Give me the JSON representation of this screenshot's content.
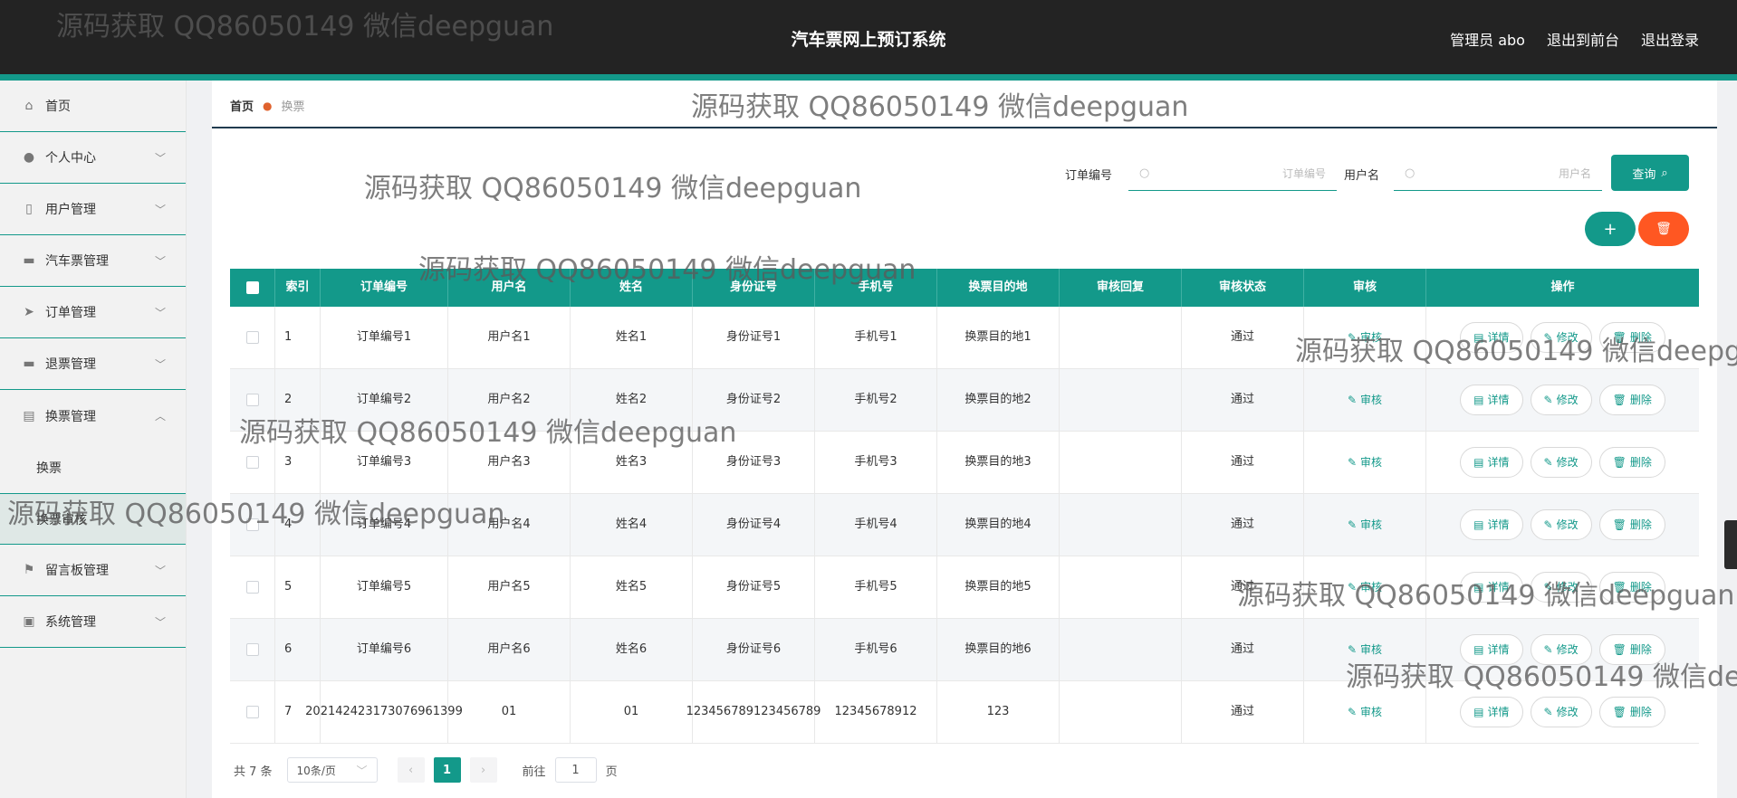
{
  "header": {
    "title": "汽车票网上预订系统",
    "admin": "管理员 abo",
    "to_front": "退出到前台",
    "logout": "退出登录"
  },
  "sidebar": {
    "items": [
      {
        "label": "首页",
        "icon": "home-icon"
      },
      {
        "label": "个人中心",
        "icon": "user-icon"
      },
      {
        "label": "用户管理",
        "icon": "phone-icon"
      },
      {
        "label": "汽车票管理",
        "icon": "monitor-icon"
      },
      {
        "label": "订单管理",
        "icon": "send-icon"
      },
      {
        "label": "退票管理",
        "icon": "monitor-icon"
      },
      {
        "label": "换票管理",
        "icon": "clipboard-icon"
      }
    ],
    "sub_items": [
      {
        "label": "换票"
      },
      {
        "label": "换票审核"
      }
    ],
    "tail_items": [
      {
        "label": "留言板管理",
        "icon": "flag-icon"
      },
      {
        "label": "系统管理",
        "icon": "briefcase-icon"
      }
    ]
  },
  "breadcrumb": {
    "home": "首页",
    "current": "换票"
  },
  "search": {
    "order_label": "订单编号",
    "order_placeholder": "订单编号",
    "user_label": "用户名",
    "user_placeholder": "用户名",
    "query_label": "查询"
  },
  "colors": {
    "primary": "#13998a",
    "danger": "#ff5722",
    "header_bg": "#232323"
  },
  "table": {
    "headers": [
      "索引",
      "订单编号",
      "用户名",
      "姓名",
      "身份证号",
      "手机号",
      "换票目的地",
      "审核回复",
      "审核状态",
      "审核",
      "操作"
    ],
    "audit_label": "审核",
    "detail_label": "详情",
    "edit_label": "修改",
    "delete_label": "删除",
    "rows": [
      {
        "idx": "1",
        "order": "订单编号1",
        "user": "用户名1",
        "name": "姓名1",
        "idcard": "身份证号1",
        "phone": "手机号1",
        "dest": "换票目的地1",
        "reply": "",
        "status": "通过"
      },
      {
        "idx": "2",
        "order": "订单编号2",
        "user": "用户名2",
        "name": "姓名2",
        "idcard": "身份证号2",
        "phone": "手机号2",
        "dest": "换票目的地2",
        "reply": "",
        "status": "通过"
      },
      {
        "idx": "3",
        "order": "订单编号3",
        "user": "用户名3",
        "name": "姓名3",
        "idcard": "身份证号3",
        "phone": "手机号3",
        "dest": "换票目的地3",
        "reply": "",
        "status": "通过"
      },
      {
        "idx": "4",
        "order": "订单编号4",
        "user": "用户名4",
        "name": "姓名4",
        "idcard": "身份证号4",
        "phone": "手机号4",
        "dest": "换票目的地4",
        "reply": "",
        "status": "通过"
      },
      {
        "idx": "5",
        "order": "订单编号5",
        "user": "用户名5",
        "name": "姓名5",
        "idcard": "身份证号5",
        "phone": "手机号5",
        "dest": "换票目的地5",
        "reply": "",
        "status": "通过"
      },
      {
        "idx": "6",
        "order": "订单编号6",
        "user": "用户名6",
        "name": "姓名6",
        "idcard": "身份证号6",
        "phone": "手机号6",
        "dest": "换票目的地6",
        "reply": "",
        "status": "通过"
      },
      {
        "idx": "7",
        "order": "202142423173076961399",
        "user": "01",
        "name": "01",
        "idcard": "123456789123456789",
        "phone": "12345678912",
        "dest": "123",
        "reply": "",
        "status": "通过"
      }
    ]
  },
  "pagination": {
    "total": "共 7 条",
    "page_size": "10条/页",
    "current_page": "1",
    "goto_prefix": "前往",
    "goto_value": "1",
    "goto_suffix": "页"
  },
  "watermark": "源码获取 QQ86050149 微信deepguan"
}
